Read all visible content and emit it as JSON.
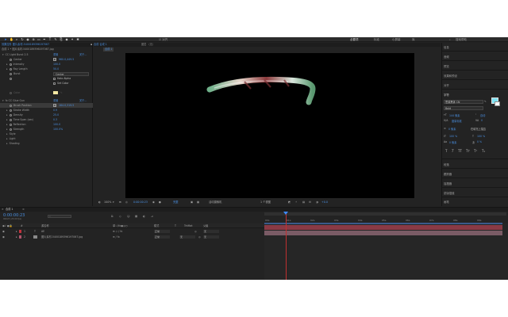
{
  "toolbar": {
    "snap_label": "对齐",
    "workspaces": [
      "必要项",
      "标准",
      "小屏幕",
      "库"
    ],
    "search_placeholder": "搜索帮助"
  },
  "effect_controls": {
    "panel_title": "效果控件 图片素材-5400189396197067",
    "layer_path": "合成 1 • 图片素材-5400189396197067.jpg",
    "effects": [
      {
        "name": "CC Light Burst 2.5",
        "reset": "重置",
        "about": "关于..."
      },
      {
        "name": "CC Glue Gun",
        "reset": "重置",
        "about": "关于..."
      }
    ],
    "burst_props": [
      {
        "label": "Center",
        "value": "960.0,449.5",
        "kind": "target"
      },
      {
        "label": "Intensity",
        "value": "100.0"
      },
      {
        "label": "Ray Length",
        "value": "50.0"
      },
      {
        "label": "Burst",
        "value": "Center",
        "kind": "dropdown"
      },
      {
        "label": "",
        "value": "Halo Alpha",
        "kind": "check"
      },
      {
        "label": "",
        "value": "Set Color",
        "kind": "check"
      },
      {
        "label": "Color",
        "value": "",
        "kind": "color"
      }
    ],
    "glue_props": [
      {
        "label": "Brush Position",
        "value": "164.0,319.5",
        "kind": "target"
      },
      {
        "label": "Stroke Width",
        "value": "0.9"
      },
      {
        "label": "Density",
        "value": "25.0"
      },
      {
        "label": "Time Span (sec)",
        "value": "0.3"
      },
      {
        "label": "Reflection",
        "value": "100.0"
      },
      {
        "label": "Strength",
        "value": "100.0%"
      },
      {
        "label": "Style",
        "value": ""
      },
      {
        "label": "Light",
        "value": ""
      },
      {
        "label": "Shading",
        "value": ""
      }
    ]
  },
  "composition": {
    "tab_label": "合成 合成 1",
    "layer_tab": "图层 （无）",
    "comp_chip": "合成 1",
    "viewer_bar": {
      "zoom": "100%",
      "timecode": "0:00:00:23",
      "resolution": "完整",
      "camera": "活动摄像机",
      "views": "1 个视图",
      "exposure": "+0.0"
    }
  },
  "right_panel": {
    "sections": [
      "信息",
      "音频",
      "预览",
      "效果和预设",
      "对齐"
    ],
    "character_title": "字符",
    "font_family": "思源黑体 CN",
    "font_style": "Bold",
    "font_size": "144 像素",
    "leading": "自动",
    "kerning": "度量标准",
    "tracking": "0",
    "stroke_size": "0 像素",
    "stroke_mode": "在填充上描边",
    "vert_scale": "100 %",
    "horiz_scale": "100 %",
    "baseline": "0 像素",
    "tsume": "0 %",
    "format_buttons": [
      "T",
      "T",
      "TT",
      "Tт",
      "T¹",
      "T₁"
    ],
    "lower_sections": [
      "段落",
      "跟踪器",
      "摇摆器",
      "蒙版插值",
      "画笔"
    ],
    "fill_color": "#7fe3f2",
    "stroke_color": "#ffffff"
  },
  "timeline": {
    "tab_label": "合成 1",
    "timecode": "0:00:00:23",
    "frame_info": "00023 (25.00 fps)",
    "headers": [
      "#",
      "源名称",
      "单☆\\fx▣◎○",
      "模式",
      "T",
      "TrkMat",
      "父级"
    ],
    "ruler_ticks": [
      "00s",
      "01s",
      "02s",
      "03s",
      "04s",
      "05s",
      "06s",
      "07s",
      "08s",
      "09s"
    ],
    "layers": [
      {
        "index": "1",
        "name": "AE",
        "type": "T",
        "mode": "正常",
        "trkmat": "",
        "parent": "无",
        "color": "#c0333c"
      },
      {
        "index": "2",
        "name": "图片素材-5400189396197067.jpg",
        "type": "img",
        "mode": "正常",
        "trkmat": "无",
        "parent": "无",
        "color": "#b0556c"
      }
    ],
    "colors": {
      "playhead": "#3d8bfd",
      "layer1_bar": "#8a3a45",
      "layer2_bar": "#7a5b65",
      "work_area": "#3a5a8a"
    }
  }
}
